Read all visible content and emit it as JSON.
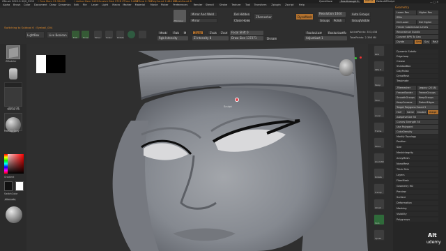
{
  "title_bar": {
    "app": "ZBrush 2022.0.3",
    "project": "QS_3295",
    "mem_free": "• Free Mem 23.394GB",
    "mem_active": "• Active Mem 2439",
    "scratch": "• Scratch Disk 9723",
    "ztime": "• ZTime 5.686",
    "rtime": "RTime 0.728",
    "polycount": "• PolyCount 2.484 MP",
    "meshcount": "• MeshCount 8",
    "quicksave": "QuickSave",
    "seethrough": "See-through 0",
    "menus_btn": "Menus",
    "default_script": "DefaultZScript"
  },
  "menu_bar": {
    "items": [
      "Alpha",
      "Brush",
      "Color",
      "Document",
      "Draw",
      "Dynamics",
      "Edit",
      "File",
      "Layer",
      "Light",
      "Macro",
      "Marker",
      "Material",
      "Movie",
      "Picker",
      "Preferences",
      "Render",
      "Stencil",
      "Stroke",
      "Texture",
      "Tool",
      "Transform",
      "Zplugin",
      "Zscript",
      "Help"
    ]
  },
  "toolbar_top": {
    "subtool_status": "Switching to Subtool 6 : Eyeball_004",
    "lightbox": "LightBox",
    "live_boolean": "Live Boolean",
    "edit": "Edit",
    "draw": "Draw",
    "move": "Move",
    "scale": "Scale",
    "rotate": "Rotate",
    "mrgb": "Mrgb",
    "rgb": "Rgb",
    "m": "M",
    "zadd": "Zadd",
    "zsub": "Zsub",
    "zcut": "Zcut",
    "rgb_intensity": "Rgb Intensity",
    "z_intensity": "Z Intensity 8",
    "focal_shift": "Focal Shift 0",
    "draw_size": "Draw Size 137271",
    "dynamic": "Dynamic",
    "replay_last": "ReplayLast",
    "replay_last_rel": "ReplayLastRel",
    "active_points": "ActivePoints: 353,438",
    "total_points": "TotalPoints: 2.398 Mil",
    "adjust_last": "AdjustLast 1",
    "mirror_weld": "Mirror And Weld",
    "del_hidden": "Del Hidden",
    "mirror": "Mirror",
    "close_holes": "Close Holes",
    "zremesher": "ZRemesher",
    "dynamesh": "DynaMesh",
    "resolution": "Resolution 1044",
    "groups": "Groups",
    "polish": "Polish",
    "auto_groups": "Auto Groups",
    "group_visible": "GroupVisible",
    "zmodeler": "ZModeler"
  },
  "left_shelf": {
    "dynamic_label": "ZModeler",
    "alpha_label": "Alpha Off",
    "texture_label": "Texture Off",
    "material_label": "MatCap Gray",
    "gradient_label": "Gradient",
    "switch_color": "SwitchColor",
    "alternate": "Alternate"
  },
  "right_strip": {
    "buttons": [
      "BPR",
      "SPix 3",
      "Persp",
      "Floor",
      "Local",
      "Frame",
      "Move",
      "Zoom3D",
      "Rotate",
      "Transp",
      "Ghost",
      "Solo",
      "Xpose"
    ]
  },
  "right_panel": {
    "header": "Geometry",
    "lower_res": "Lower Res",
    "higher_res": "Higher Res",
    "sdiv": "SDiv",
    "del_lower": "Del Lower",
    "del_higher": "Del Higher",
    "freeze_subdiv": "Freeze SubDivision Levels",
    "reconstruct_subdiv": "Reconstruct Subdiv",
    "convert_bpr": "Convert BPR To Geo",
    "divide": "Divide",
    "smt": "Smt",
    "suv": "Suv",
    "reuv": "ReUV",
    "dynamic_subdiv": "Dynamic Subdiv",
    "edge_loop": "EdgeLoop",
    "crease": "Crease",
    "shadowbox": "ShadowBox",
    "clay_polish": "ClayPolish",
    "dynamesh": "DynaMesh",
    "tessimate": "Tessimate",
    "zremesher": "ZRemesher",
    "legacy": "Legacy (2018)",
    "freeze_border": "FreezeBorder",
    "freeze_groups": "FreezeGroups",
    "smooth_groups": "SmoothGroups",
    "keep_groups": "KeepGroups",
    "keep_creases": "KeepCreases",
    "detect_edges": "DetectEdges",
    "target_polys": "Target Polygons Count 5",
    "half": "Half",
    "same": "Same",
    "double": "Double",
    "adapt": "Adapt",
    "adaptive_size": "AdaptiveSize 50",
    "curves_strength": "Curves Strength 50",
    "use_polypaint": "Use Polypaint",
    "color_density": "ColorDensity",
    "modify_topology": "Modify Topology",
    "sections": [
      "Position",
      "Size",
      "MeshIntegrity",
      "ArrayMesh",
      "NanoMesh",
      "Thick Skin",
      "Layers",
      "FiberMesh",
      "Geometry HD",
      "Preview",
      "Surface",
      "Deformation",
      "Masking",
      "Visibility",
      "Polygroups"
    ]
  },
  "viewport": {
    "cursor_label": "Sculpt"
  },
  "watermark": {
    "top": "Alt",
    "bottom": "udemy"
  },
  "colors": {
    "accent": "#e08a2c",
    "active_green": "#3f7a3f",
    "clay": "#8a8c90",
    "panel_bg": "#2a2a2a"
  }
}
